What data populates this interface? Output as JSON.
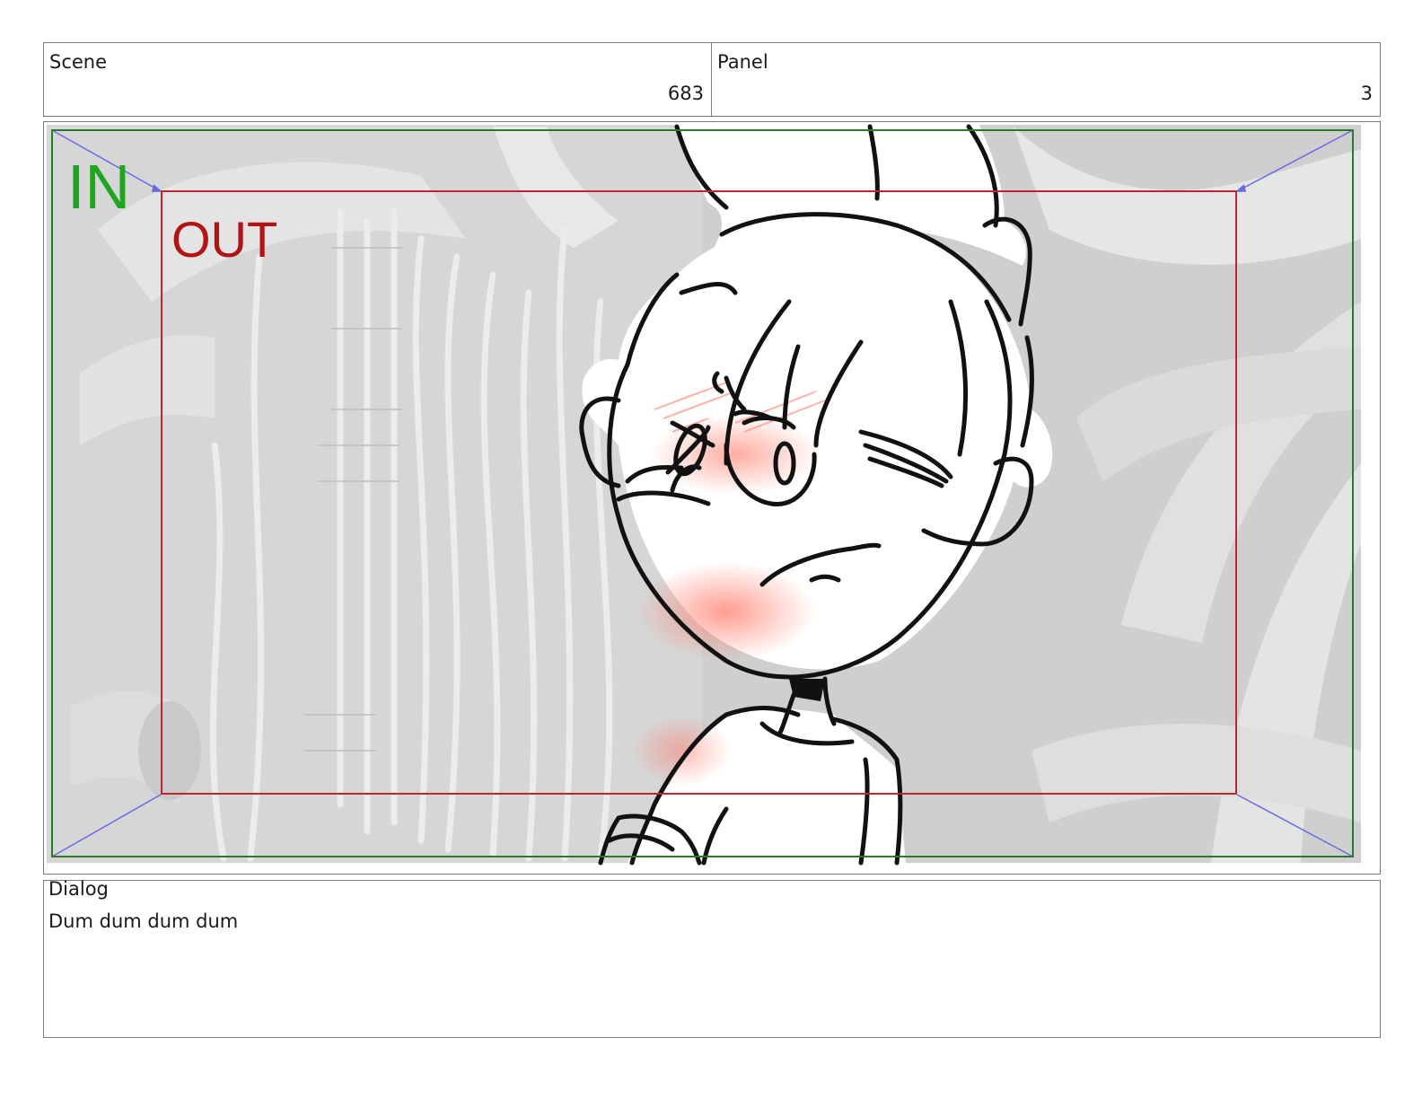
{
  "scene": {
    "label": "Scene",
    "value": "683"
  },
  "panel": {
    "label": "Panel",
    "value": "3"
  },
  "frame": {
    "in_label": "IN",
    "out_label": "OUT",
    "colors": {
      "in": "#1fa51f",
      "out": "#b01414",
      "in_border": "#2a7a2a",
      "out_border": "#c0272d",
      "guide": "#6a6ae6",
      "blush": "#ff7d6b"
    }
  },
  "dialog": {
    "label": "Dialog",
    "text": "Dum dum dum dum"
  }
}
